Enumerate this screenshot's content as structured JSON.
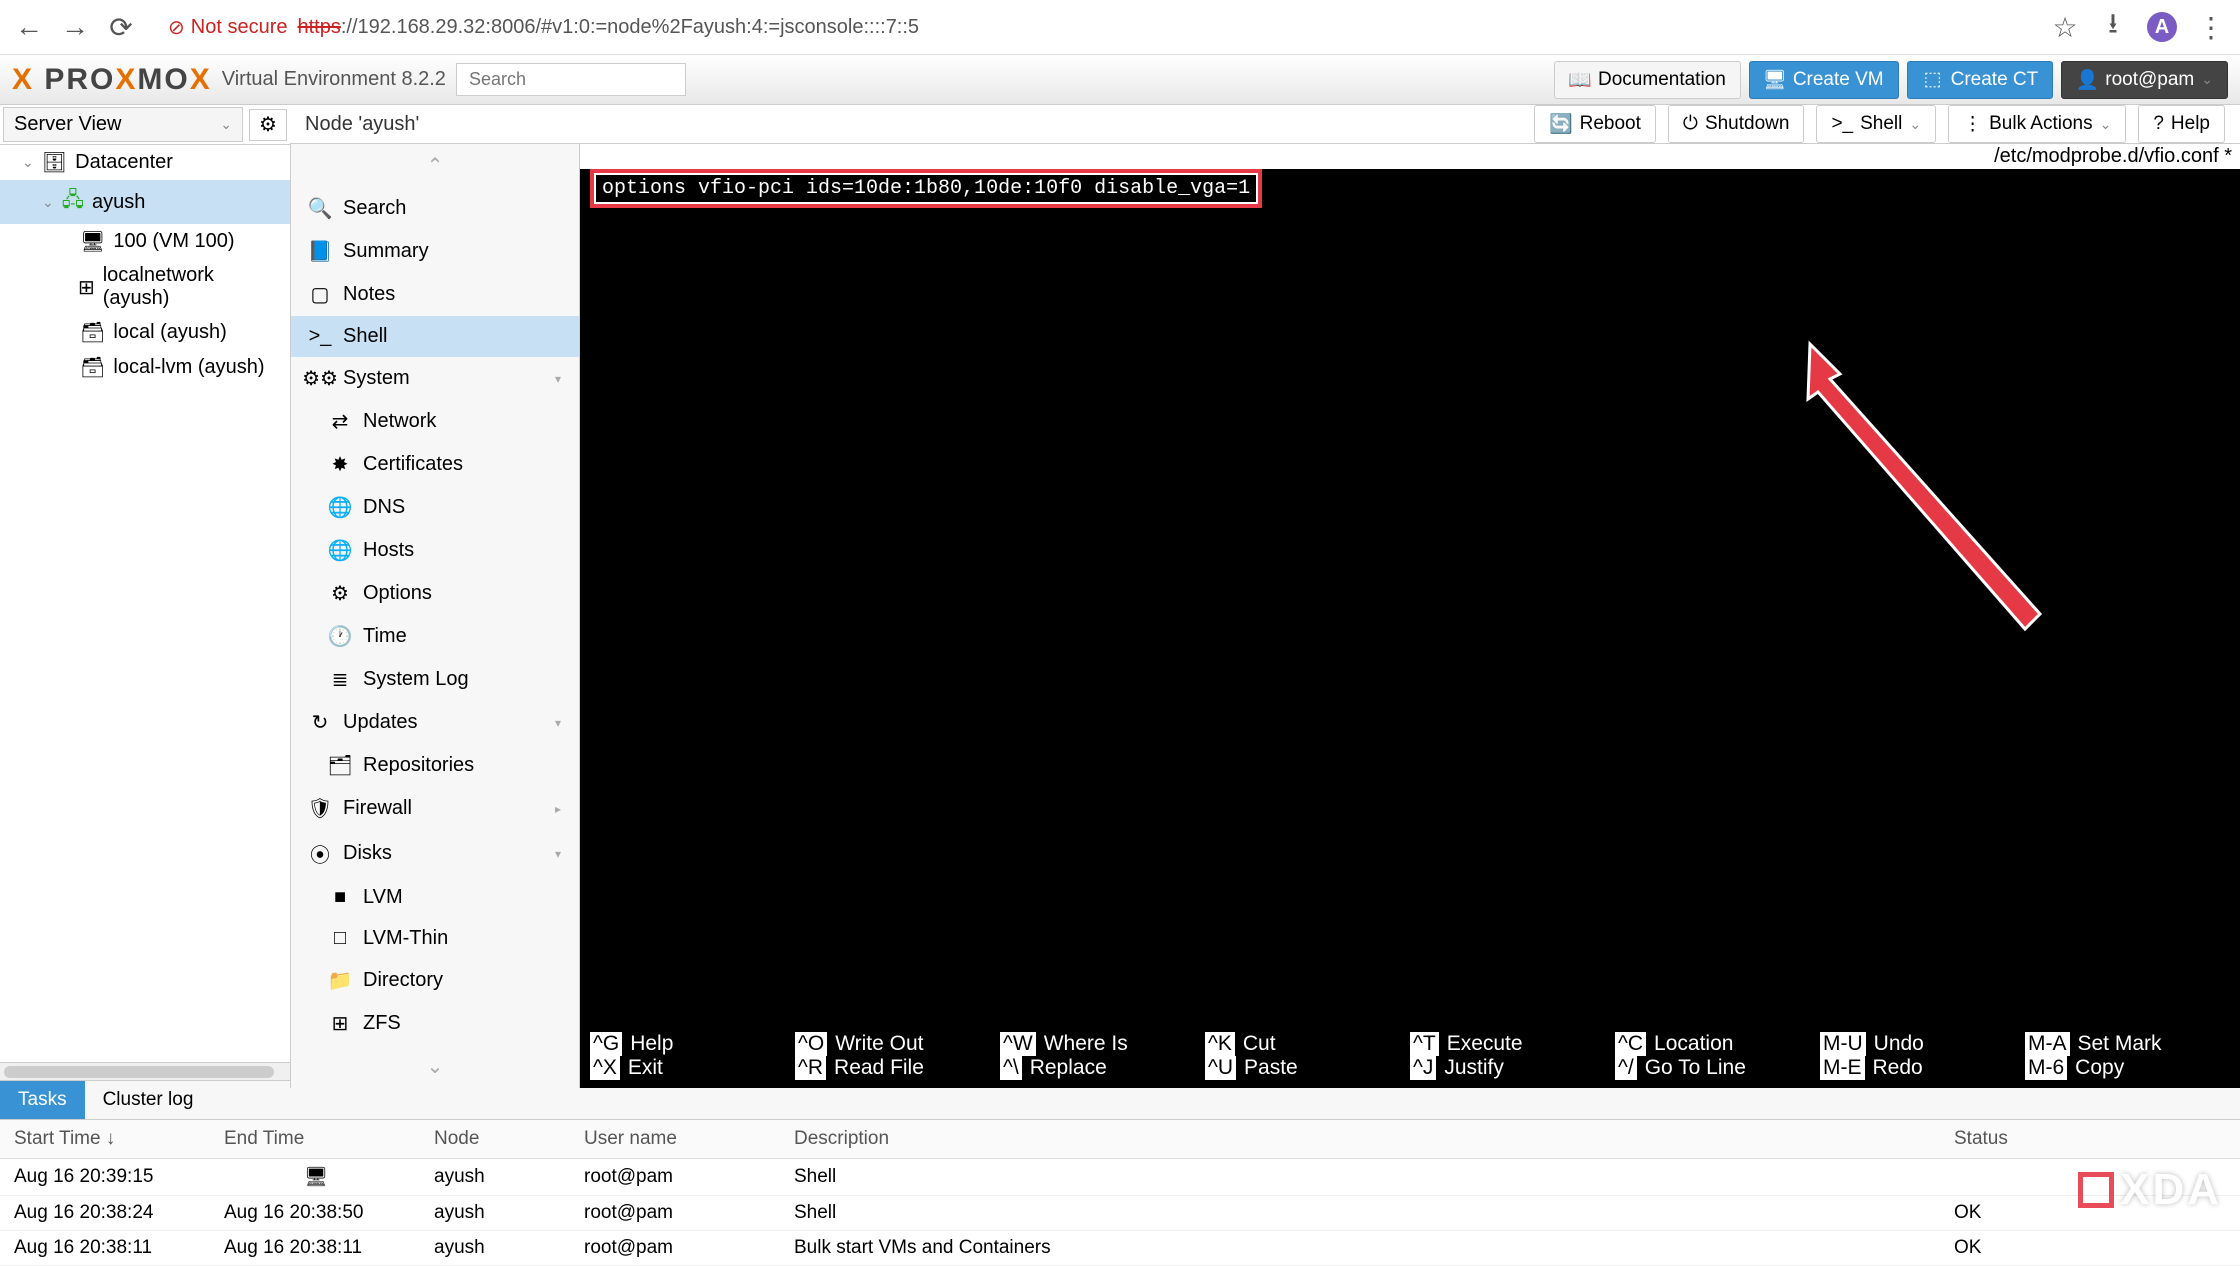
{
  "browser": {
    "not_secure": "Not secure",
    "url_proto": "https",
    "url_rest": "://192.168.29.32:8006/#v1:0:=node%2Fayush:4:=jsconsole::::7::5",
    "avatar_letter": "A"
  },
  "header": {
    "ve_label": "Virtual Environment 8.2.2",
    "search_placeholder": "Search",
    "doc": "Documentation",
    "create_vm": "Create VM",
    "create_ct": "Create CT",
    "user": "root@pam"
  },
  "server_view": {
    "label": "Server View"
  },
  "tree": {
    "datacenter": "Datacenter",
    "node": "ayush",
    "vm": "100 (VM 100)",
    "localnetwork": "localnetwork (ayush)",
    "local": "local (ayush)",
    "locallvm": "local-lvm (ayush)"
  },
  "content_header": {
    "title": "Node 'ayush'"
  },
  "actions": {
    "reboot": "Reboot",
    "shutdown": "Shutdown",
    "shell": "Shell",
    "bulk": "Bulk Actions",
    "help": "Help"
  },
  "sidemenu": {
    "search": "Search",
    "summary": "Summary",
    "notes": "Notes",
    "shell": "Shell",
    "system": "System",
    "network": "Network",
    "certificates": "Certificates",
    "dns": "DNS",
    "hosts": "Hosts",
    "options": "Options",
    "time": "Time",
    "systemlog": "System Log",
    "updates": "Updates",
    "repositories": "Repositories",
    "firewall": "Firewall",
    "disks": "Disks",
    "lvm": "LVM",
    "lvmthin": "LVM-Thin",
    "directory": "Directory",
    "zfs": "ZFS"
  },
  "terminal": {
    "file_path": "/etc/modprobe.d/vfio.conf *",
    "highlighted_line": "options vfio-pci ids=10de:1b80,10de:10f0 disable_vga=1",
    "nano": [
      {
        "k": "^G",
        "l": "Help"
      },
      {
        "k": "^O",
        "l": "Write Out"
      },
      {
        "k": "^W",
        "l": "Where Is"
      },
      {
        "k": "^K",
        "l": "Cut"
      },
      {
        "k": "^T",
        "l": "Execute"
      },
      {
        "k": "^C",
        "l": "Location"
      },
      {
        "k": "M-U",
        "l": "Undo"
      },
      {
        "k": "M-A",
        "l": "Set Mark"
      },
      {
        "k": "^X",
        "l": "Exit"
      },
      {
        "k": "^R",
        "l": "Read File"
      },
      {
        "k": "^\\",
        "l": "Replace"
      },
      {
        "k": "^U",
        "l": "Paste"
      },
      {
        "k": "^J",
        "l": "Justify"
      },
      {
        "k": "^/",
        "l": "Go To Line"
      },
      {
        "k": "M-E",
        "l": "Redo"
      },
      {
        "k": "M-6",
        "l": "Copy"
      }
    ]
  },
  "bottom": {
    "tasks": "Tasks",
    "cluster_log": "Cluster log",
    "cols": {
      "start": "Start Time ↓",
      "end": "End Time",
      "node": "Node",
      "user": "User name",
      "desc": "Description",
      "status": "Status"
    },
    "rows": [
      {
        "start": "Aug 16 20:39:15",
        "end": "",
        "end_icon": "🖥",
        "node": "ayush",
        "user": "root@pam",
        "desc": "Shell",
        "status": ""
      },
      {
        "start": "Aug 16 20:38:24",
        "end": "Aug 16 20:38:50",
        "node": "ayush",
        "user": "root@pam",
        "desc": "Shell",
        "status": "OK"
      },
      {
        "start": "Aug 16 20:38:11",
        "end": "Aug 16 20:38:11",
        "node": "ayush",
        "user": "root@pam",
        "desc": "Bulk start VMs and Containers",
        "status": "OK"
      }
    ]
  },
  "watermark": "XDA"
}
